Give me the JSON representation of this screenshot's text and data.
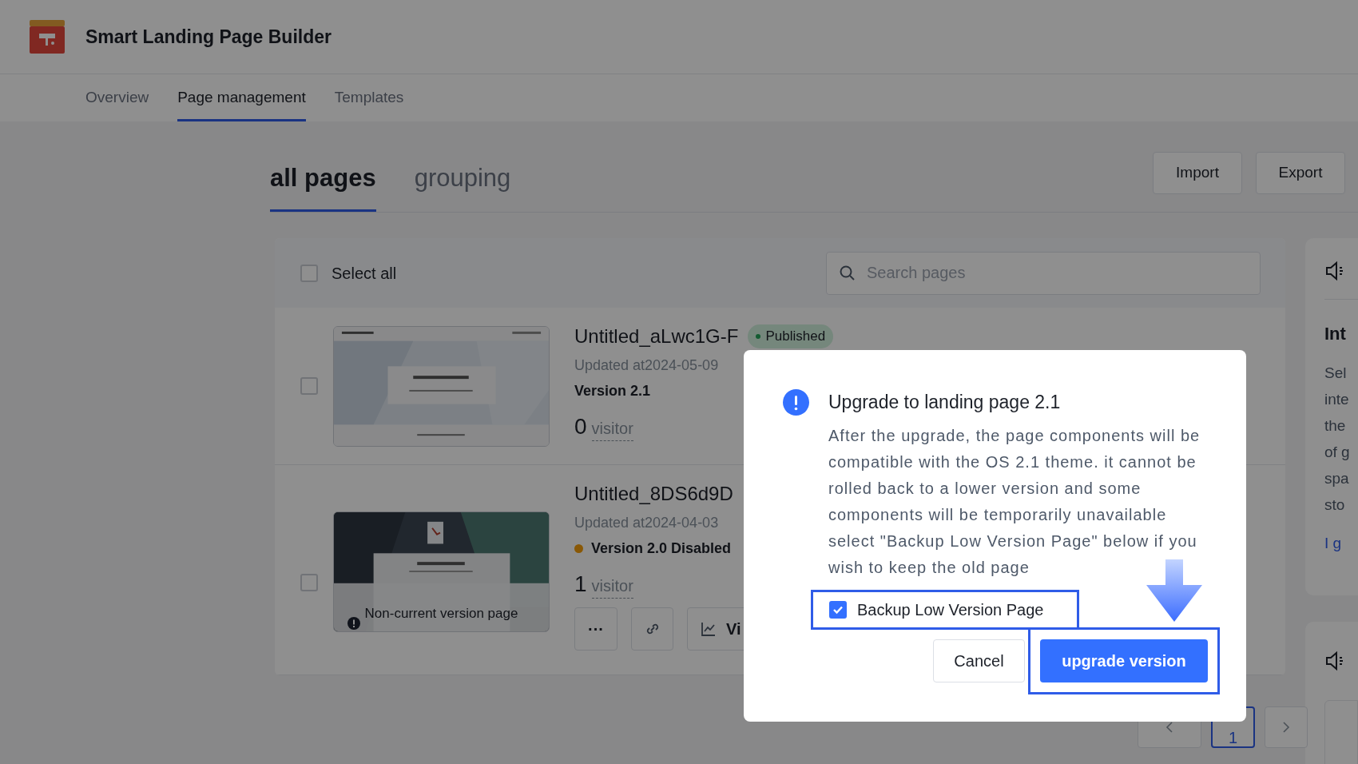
{
  "app": {
    "title": "Smart Landing Page Builder"
  },
  "nav_tabs": [
    {
      "label": "Overview",
      "selected": false
    },
    {
      "label": "Page management",
      "selected": true
    },
    {
      "label": "Templates",
      "selected": false
    }
  ],
  "view_tabs": [
    {
      "label": "all pages",
      "selected": true
    },
    {
      "label": "grouping",
      "selected": false
    }
  ],
  "toolbar_buttons": [
    "Import",
    "Export"
  ],
  "list": {
    "select_all": {
      "label": "Select all",
      "checked": false
    },
    "search": {
      "placeholder": "Search pages"
    },
    "rows": [
      {
        "title": "Untitled_aLwc1G-F",
        "badge": "Published",
        "updated": "Updated at2024-05-09",
        "version": "Version 2.1",
        "disabled": false,
        "visitor_count": "0",
        "visitor_label": "visitor",
        "checked": false
      },
      {
        "title": "Untitled_8DS6d9D",
        "updated": "Updated at2024-04-03",
        "version": "Version 2.0 Disabled",
        "disabled": true,
        "visitor_count": "1",
        "visitor_label": "visitor",
        "checked": false,
        "thumbnail_note": "Non-current version page",
        "actions": [
          {
            "kind": "more",
            "label": "···"
          },
          {
            "kind": "link"
          },
          {
            "kind": "view",
            "label": "Vi"
          }
        ]
      }
    ]
  },
  "pagination": {
    "pages": [
      {
        "label": "1",
        "selected": true
      }
    ]
  },
  "side_panel": {
    "title": "Int",
    "lines": [
      "Sel",
      "inte",
      "the",
      "of g",
      "spa",
      "sto"
    ],
    "link": "I g"
  },
  "dialog": {
    "title": "Upgrade to landing page 2.1",
    "body": "After the upgrade, the page components will be compatible with the OS 2.1 theme. it cannot be rolled back to a lower version and some components will be temporarily unavailable select \"Backup Low Version Page\" below if you wish to keep the old page",
    "backup": {
      "label": "Backup Low Version Page",
      "checked": true,
      "highlighted": true
    },
    "buttons": [
      {
        "label": "Cancel",
        "kind": "secondary",
        "highlighted": false
      },
      {
        "label": "upgrade version",
        "kind": "primary",
        "highlighted": true
      }
    ]
  }
}
